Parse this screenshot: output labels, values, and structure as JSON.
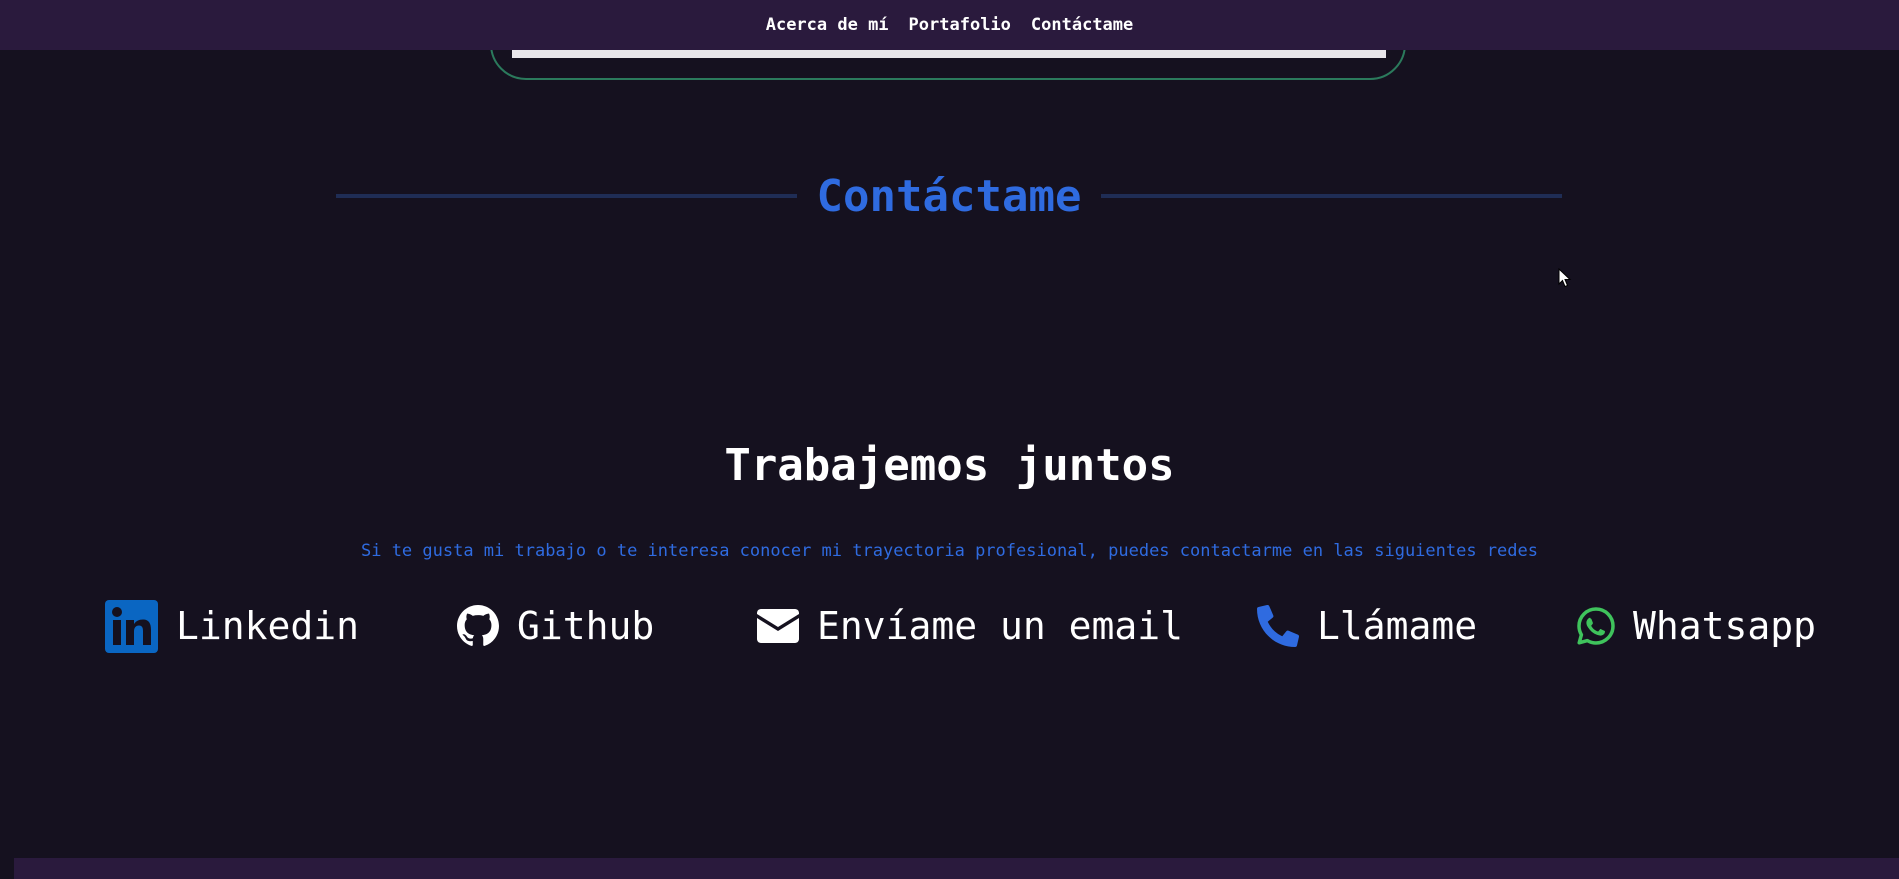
{
  "nav": {
    "items": [
      {
        "label": "Acerca de mí"
      },
      {
        "label": "Portafolio"
      },
      {
        "label": "Contáctame"
      }
    ]
  },
  "contact_section": {
    "title": "Contáctame",
    "subheading": "Trabajemos juntos",
    "description": "Si te gusta mi trabajo o te interesa conocer mi trayectoria profesional, puedes contactarme en las siguientes redes",
    "links": [
      {
        "label": "Linkedin",
        "icon": "linkedin-icon",
        "color": "#0a66c2"
      },
      {
        "label": "Github",
        "icon": "github-icon",
        "color": "#ffffff"
      },
      {
        "label": "Envíame un email",
        "icon": "envelope-icon",
        "color": "#ffffff"
      },
      {
        "label": "Llámame",
        "icon": "phone-icon",
        "color": "#2f6be0"
      },
      {
        "label": "Whatsapp",
        "icon": "whatsapp-icon",
        "color": "#3fc35c"
      }
    ]
  },
  "colors": {
    "background": "#15111f",
    "navbar": "#2a1a3d",
    "accent_blue": "#2f6be0",
    "card_border": "#2b7a5c"
  }
}
